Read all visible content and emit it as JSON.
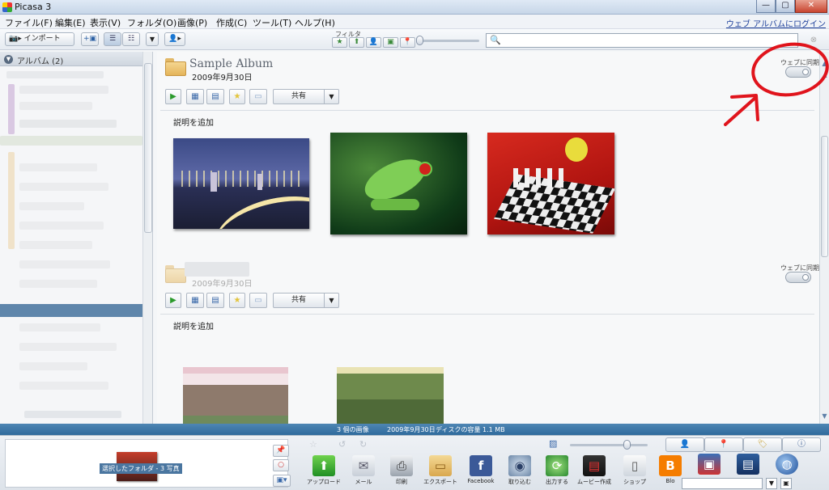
{
  "window": {
    "title": "Picasa 3"
  },
  "menu": {
    "items": [
      "ファイル(F)",
      "編集(E)",
      "表示(V)",
      "フォルダ(O)",
      "画像(P)",
      "作成(C)",
      "ツール(T)",
      "ヘルプ(H)"
    ],
    "login_link": "ウェブ アルバムにログイン"
  },
  "toolbar": {
    "import_label": "インポート",
    "filter_label": "フィルタ",
    "search_value": ""
  },
  "left_panel": {
    "header": "アルバム (2)"
  },
  "albums": [
    {
      "name": "Sample Album",
      "date": "2009年9月30日",
      "sync_label": "ウェブに同期",
      "share_label": "共有",
      "description_placeholder": "説明を追加",
      "photos": [
        "city-night-photo",
        "frog-photo",
        "parrot-chess-photo"
      ]
    },
    {
      "name": "",
      "date": "2009年9月30日",
      "sync_label": "ウェブに同期",
      "share_label": "共有",
      "description_placeholder": "説明を追加"
    }
  ],
  "status": {
    "image_count": "3 個の画像",
    "date": "2009年9月30日",
    "disk_usage": "ディスクの容量 1.1 MB"
  },
  "tray": {
    "holder_label": "選択したフォルダ - 3 写真",
    "tools": [
      "アップロード",
      "メール",
      "印刷",
      "エクスポート",
      "Facebook",
      "取り込む",
      "出力する",
      "ムービー作成",
      "ショップ",
      "Blo"
    ]
  },
  "colors": {
    "accent": "#2f6a9c",
    "annotation": "#e0141c"
  }
}
